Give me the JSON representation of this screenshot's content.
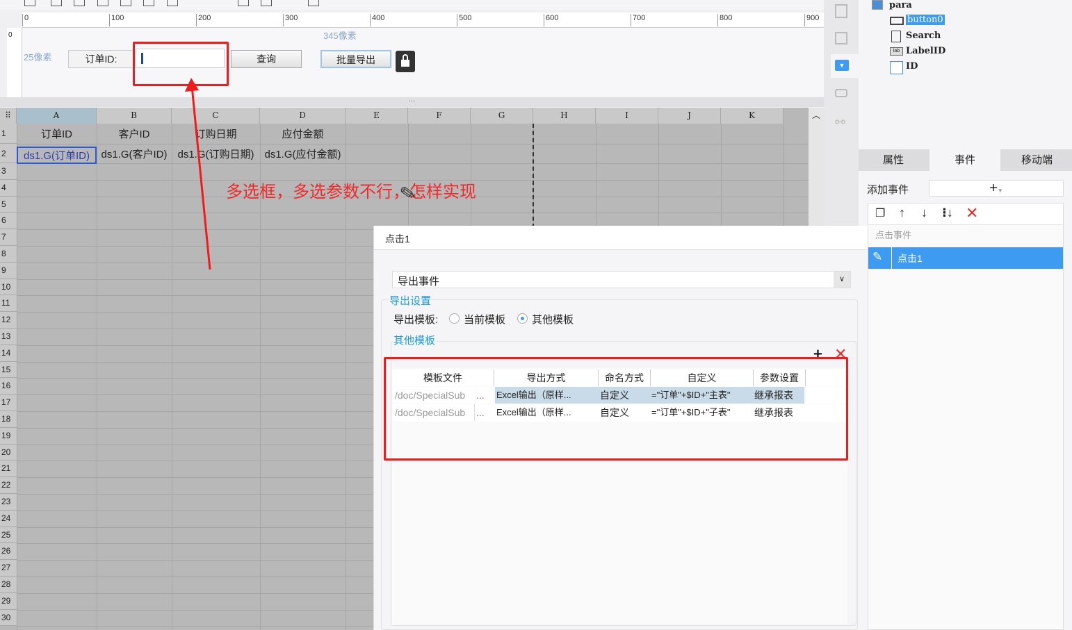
{
  "ruler": {
    "ticks": [
      "0",
      "100",
      "200",
      "300",
      "400",
      "500",
      "600",
      "700",
      "800",
      "900"
    ],
    "vertical_zero": "0"
  },
  "canvas": {
    "hint_left": "25像素",
    "hint_top": "345像素",
    "label": "订单ID:",
    "input_value": "",
    "query_button": "查询",
    "export_button": "批量导出"
  },
  "sheet": {
    "columns": [
      "A",
      "B",
      "C",
      "D",
      "E",
      "F",
      "G",
      "H",
      "I",
      "J",
      "K"
    ],
    "rows": [
      "1",
      "2",
      "3",
      "4",
      "5",
      "6",
      "7",
      "8",
      "9",
      "10",
      "11",
      "12",
      "13",
      "14",
      "15",
      "16",
      "17",
      "18",
      "19",
      "20",
      "21",
      "22",
      "23",
      "24",
      "25",
      "26",
      "27",
      "28",
      "29",
      "30"
    ],
    "header_cells": [
      "订单ID",
      "客户ID",
      "订购日期",
      "应付金额"
    ],
    "data_cells": [
      "ds1.G(订单ID)",
      "ds1.G(客户ID)",
      "ds1.G(订购日期)",
      "ds1.G(应付金额)"
    ]
  },
  "annotation": "多选框，多选参数不行，怎样实现",
  "tree": {
    "root": "para",
    "items": [
      "button0",
      "Search",
      "LabelID",
      "ID"
    ]
  },
  "panel_tabs": [
    "属性",
    "事件",
    "移动端"
  ],
  "events": {
    "add_label": "添加事件",
    "add_button": "+",
    "group": "点击事件",
    "selected": "点击1"
  },
  "dialog": {
    "title": "点击1",
    "event_type": "导出事件",
    "section_export": "导出设置",
    "template_label": "导出模板:",
    "radio_current": "当前模板",
    "radio_other": "其他模板",
    "radio_selected": "其他模板",
    "section_other": "其他模板",
    "table": {
      "headers": [
        "模板文件",
        "导出方式",
        "命名方式",
        "自定义",
        "参数设置"
      ],
      "rows": [
        {
          "file": "/doc/SpecialSub",
          "more": "...",
          "method": "Excel输出（原样...",
          "naming": "自定义",
          "custom": "=\"订单\"+$ID+\"主表\"",
          "params": "继承报表"
        },
        {
          "file": "/doc/SpecialSub",
          "more": "...",
          "method": "Excel输出（原样...",
          "naming": "自定义",
          "custom": "=\"订单\"+$ID+\"子表\"",
          "params": "继承报表"
        }
      ]
    }
  },
  "colors": {
    "accent": "#3d9bf2",
    "annotation": "#f01c1c",
    "section": "#1a9be0"
  }
}
